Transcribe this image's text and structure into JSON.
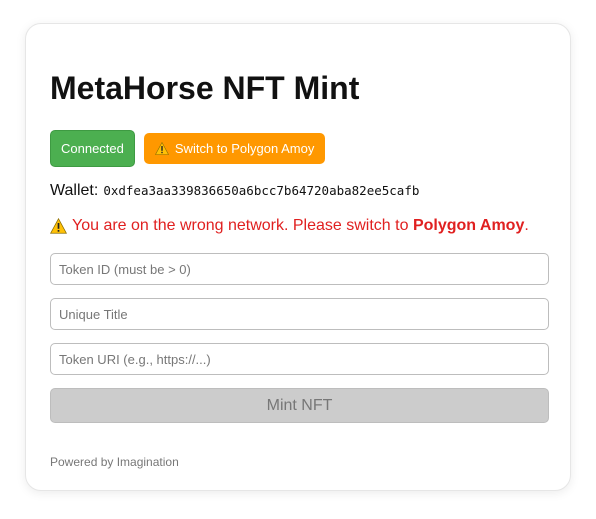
{
  "app": {
    "title": "MetaHorse NFT Mint"
  },
  "buttons": {
    "connected_label": "Connected",
    "switch_label": "Switch to Polygon Amoy",
    "mint_label": "Mint NFT"
  },
  "wallet": {
    "label": "Wallet:",
    "address": "0xdfea3aa339836650a6bcc7b64720aba82ee5cafb"
  },
  "warning": {
    "text_before": "You are on the wrong network. Please switch to",
    "network_name": "Polygon Amoy",
    "text_after": "."
  },
  "form": {
    "token_id_placeholder": "Token ID (must be > 0)",
    "title_placeholder": "Unique Title",
    "uri_placeholder": "Token URI (e.g., https://...)"
  },
  "footer": {
    "text": "Powered by Imagination"
  },
  "colors": {
    "connected": "#4caf50",
    "switch": "#ff9800",
    "warning_text": "#e02020",
    "warning_icon": "#ffc107",
    "mint_disabled": "#cccccc"
  },
  "icons": {
    "warning": "warning-icon"
  }
}
